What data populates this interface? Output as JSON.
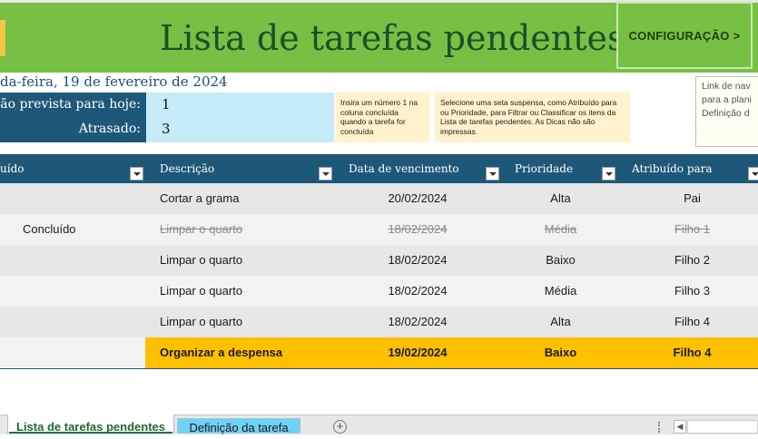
{
  "title": "Lista de tarefas pendentes",
  "config_button": "CONFIGURAÇÃO >",
  "date_line": "da-feira, 19 de fevereiro de 2024",
  "stats": {
    "due_today_label": "lusão prevista para hoje:",
    "due_today_value": "1",
    "overdue_label": "Atrasado:",
    "overdue_value": "3"
  },
  "tips": {
    "tip1": "Insira um número 1 na coluna concluída quando a tarefa for concluída",
    "tip2": "Selecione uma seta suspensa, como Atribuído para ou Prioridade, para Filtrar ou Classificar os itens da Lista de tarefas pendentes. As Dicas não são impressas."
  },
  "nav_note": {
    "line1": "Link de nav",
    "line2": "para a plani",
    "line3": "Definição d"
  },
  "table": {
    "headers": {
      "status": "uído",
      "description": "Descrição",
      "due_date": "Data de vencimento",
      "priority": "Prioridade",
      "assigned": "Atribuído para"
    },
    "rows": [
      {
        "status": "",
        "description": "Cortar a grama",
        "due_date": "20/02/2024",
        "priority": "Alta",
        "assigned": "Pai"
      },
      {
        "status": "Concluído",
        "description": "Limpar o quarto",
        "due_date": "18/02/2024",
        "priority": "Média",
        "assigned": "Filho 1"
      },
      {
        "status": "",
        "description": "Limpar o quarto",
        "due_date": "18/02/2024",
        "priority": "Baixo",
        "assigned": "Filho 2"
      },
      {
        "status": "",
        "description": "Limpar o quarto",
        "due_date": "18/02/2024",
        "priority": "Média",
        "assigned": "Filho 3"
      },
      {
        "status": "",
        "description": "Limpar o quarto",
        "due_date": "18/02/2024",
        "priority": "Alta",
        "assigned": "Filho 4"
      },
      {
        "status": "",
        "description": "Organizar a despensa",
        "due_date": "19/02/2024",
        "priority": "Baixo",
        "assigned": "Filho 4"
      }
    ]
  },
  "sheet_tabs": {
    "active": "Lista de tarefas pendentes",
    "second": "Definição da tarefa",
    "add": "+"
  },
  "colors": {
    "banner": "#76c043",
    "header": "#1d5878",
    "highlight": "#ffc000",
    "stats_value_bg": "#c6ecfa",
    "tip_bg": "#fff2cc"
  }
}
